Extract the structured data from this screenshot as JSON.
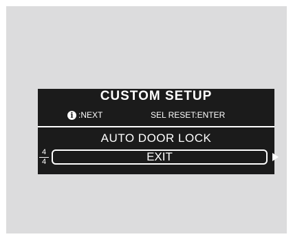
{
  "screen": {
    "title": "CUSTOM SETUP",
    "hint_info_icon": "i",
    "hint_next": ":NEXT",
    "hint_reset": "SEL RESET:ENTER",
    "menu_item": "AUTO DOOR LOCK",
    "page_current": "4",
    "page_total": "4",
    "selected_option": "EXIT",
    "icons": [
      "info-icon",
      "right-arrow-icon"
    ]
  }
}
